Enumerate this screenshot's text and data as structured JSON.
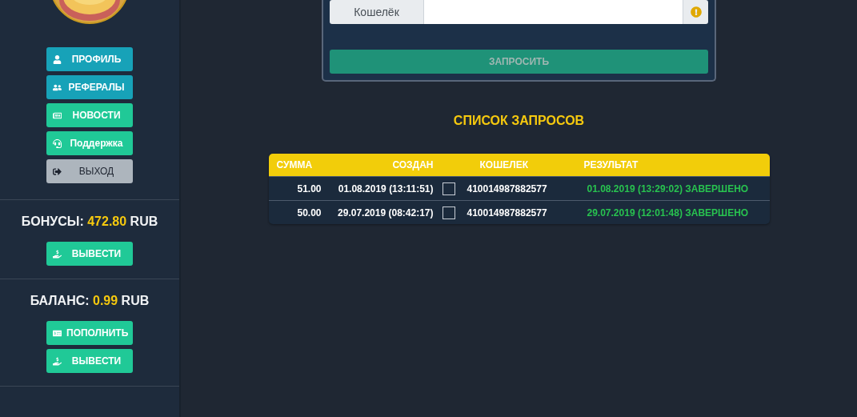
{
  "sidebar": {
    "buttons": [
      {
        "label": "ПРОФИЛЬ",
        "kind": "profile"
      },
      {
        "label": "РЕФЕРАЛЫ",
        "kind": "referrals"
      },
      {
        "label": "НОВОСТИ",
        "kind": "news"
      },
      {
        "label": "Поддержка",
        "kind": "support"
      },
      {
        "label": "ВЫХОД",
        "kind": "logout"
      }
    ],
    "bonus": {
      "label": "БОНУСЫ:",
      "amount": "472.80",
      "currency": "RUB",
      "buttons": [
        {
          "label": "ВЫВЕСТИ",
          "kind": "withdraw"
        }
      ]
    },
    "balance": {
      "label": "БАЛАНС:",
      "amount": "0.99",
      "currency": "RUB",
      "buttons": [
        {
          "label": "ПОПОЛНИТЬ",
          "kind": "deposit"
        },
        {
          "label": "ВЫВЕСТИ",
          "kind": "withdraw"
        }
      ]
    }
  },
  "form": {
    "wallet_label": "Кошелёк",
    "submit": "ЗАПРОСИТЬ"
  },
  "requests": {
    "title": "СПИСОК ЗАПРОСОВ",
    "columns": [
      "СУММА",
      "СОЗДАН",
      "КОШЕЛЕК",
      "РЕЗУЛЬТАТ"
    ],
    "rows": [
      {
        "amount": "51.00",
        "created": "01.08.2019 (13:11:51)",
        "checked": false,
        "wallet": "410014987882577",
        "result": "01.08.2019 (13:29:02) ЗАВЕРШЕНО"
      },
      {
        "amount": "50.00",
        "created": "29.07.2019 (08:42:17)",
        "checked": false,
        "wallet": "410014987882577",
        "result": "29.07.2019 (12:01:48) ЗАВЕРШЕНО"
      }
    ]
  }
}
